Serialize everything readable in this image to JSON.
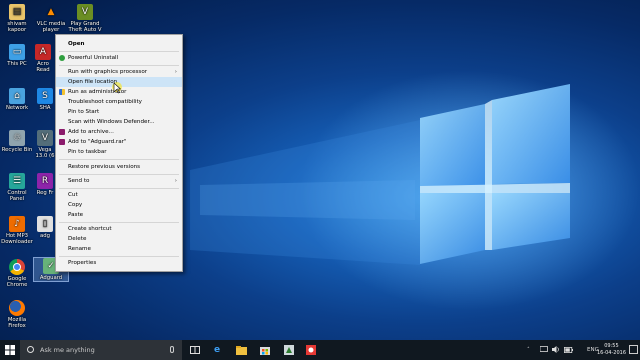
{
  "desktop": {
    "icons": [
      {
        "label": "shivam kapoor"
      },
      {
        "label": "VLC media player"
      },
      {
        "label": "Play Grand Theft Auto V"
      },
      {
        "label": "This PC"
      },
      {
        "label": "Acro Read"
      },
      {
        "label": "Network"
      },
      {
        "label": "SHA"
      },
      {
        "label": "Recycle Bin"
      },
      {
        "label": "Vega 13.0 (6"
      },
      {
        "label": "Control Panel"
      },
      {
        "label": "Reg Fr"
      },
      {
        "label": "Hot MP3 Downloader"
      },
      {
        "label": "adg"
      },
      {
        "label": "Google Chrome"
      },
      {
        "label": "Adguard"
      },
      {
        "label": "Mozilla Firefox"
      }
    ]
  },
  "context_menu": {
    "items": {
      "open": "Open",
      "powerful_uninstall": "Powerful Uninstall",
      "run_graphics": "Run with graphics processor",
      "open_file_location": "Open file location",
      "run_admin": "Run as administrator",
      "troubleshoot": "Troubleshoot compatibility",
      "pin_start": "Pin to Start",
      "scan_defender": "Scan with Windows Defender...",
      "add_archive": "Add to archive...",
      "add_rar": "Add to \"Adguard.rar\"",
      "pin_taskbar": "Pin to taskbar",
      "restore_versions": "Restore previous versions",
      "send_to": "Send to",
      "cut": "Cut",
      "copy": "Copy",
      "paste": "Paste",
      "create_shortcut": "Create shortcut",
      "delete": "Delete",
      "rename": "Rename",
      "properties": "Properties"
    },
    "submenu_arrow": "›"
  },
  "taskbar": {
    "search_placeholder": "Ask me anything",
    "language": "ENG",
    "time": "09:55",
    "date": "16-04-2016",
    "icons": [
      "windows-start-icon",
      "task-view-icon",
      "edge-icon",
      "file-explorer-icon",
      "store-icon",
      "app-icon",
      "media-icon"
    ]
  },
  "colors": {
    "accent_blue": "#1660b8",
    "menu_bg": "#f2f2f2",
    "menu_highlight": "#cde4f7",
    "taskbar": "#101820"
  }
}
